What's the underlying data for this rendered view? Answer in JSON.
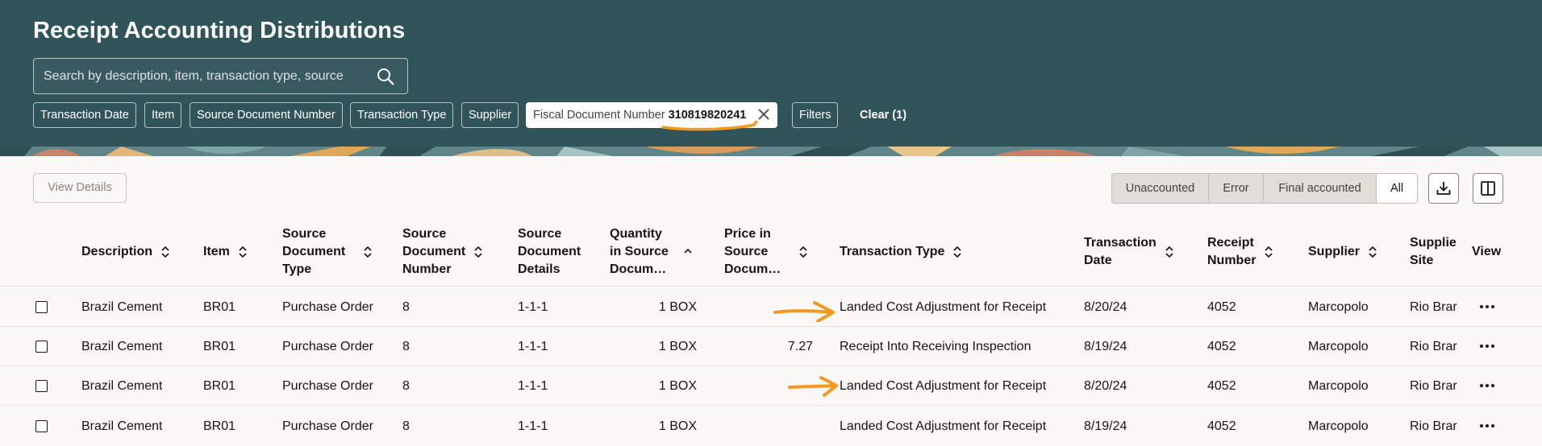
{
  "page": {
    "title": "Receipt Accounting Distributions",
    "search": {
      "placeholder": "Search by description, item, transaction type, source"
    },
    "filter_chips": [
      {
        "label": "Transaction Date"
      },
      {
        "label": "Item"
      },
      {
        "label": "Source Document Number"
      },
      {
        "label": "Transaction Type"
      },
      {
        "label": "Supplier"
      },
      {
        "label": "Fiscal Document Number",
        "value": "310819820241",
        "active": true
      },
      {
        "label": "Filters"
      }
    ],
    "clear_label": "Clear (1)"
  },
  "toolbar": {
    "view_details_label": "View Details",
    "segments": [
      {
        "label": "Unaccounted"
      },
      {
        "label": "Error"
      },
      {
        "label": "Final accounted"
      },
      {
        "label": "All",
        "selected": true
      }
    ],
    "download_icon": "download-icon",
    "columns_icon": "column-layout-icon"
  },
  "table": {
    "columns": [
      {
        "label": "Description"
      },
      {
        "label": "Item"
      },
      {
        "label": "Source\nDocument\nType"
      },
      {
        "label": "Source\nDocument\nNumber"
      },
      {
        "label": "Source\nDocument\nDetails"
      },
      {
        "label": "Quantity\nin Source\nDocum…",
        "sort": "ascending"
      },
      {
        "label": "Price in\nSource\nDocum…"
      },
      {
        "label": "Transaction Type"
      },
      {
        "label": "Transaction\nDate"
      },
      {
        "label": "Receipt\nNumber"
      },
      {
        "label": "Supplier"
      },
      {
        "label": "Supplie\nSite"
      },
      {
        "label": "View"
      }
    ],
    "rows": [
      {
        "description": "Brazil Cement",
        "item": "BR01",
        "source_doc_type": "Purchase Order",
        "source_doc_number": "8",
        "source_doc_details": "1-1-1",
        "quantity": "1 BOX",
        "price": "",
        "transaction_type": "Landed Cost Adjustment for Receipt",
        "transaction_date": "8/20/24",
        "receipt_number": "4052",
        "supplier": "Marcopolo",
        "supplier_site": "Rio Brar"
      },
      {
        "description": "Brazil Cement",
        "item": "BR01",
        "source_doc_type": "Purchase Order",
        "source_doc_number": "8",
        "source_doc_details": "1-1-1",
        "quantity": "1 BOX",
        "price": "7.27",
        "transaction_type": "Receipt Into Receiving Inspection",
        "transaction_date": "8/19/24",
        "receipt_number": "4052",
        "supplier": "Marcopolo",
        "supplier_site": "Rio Brar"
      },
      {
        "description": "Brazil Cement",
        "item": "BR01",
        "source_doc_type": "Purchase Order",
        "source_doc_number": "8",
        "source_doc_details": "1-1-1",
        "quantity": "1 BOX",
        "price": "",
        "transaction_type": "Landed Cost Adjustment for Receipt",
        "transaction_date": "8/20/24",
        "receipt_number": "4052",
        "supplier": "Marcopolo",
        "supplier_site": "Rio Brar"
      },
      {
        "description": "Brazil Cement",
        "item": "BR01",
        "source_doc_type": "Purchase Order",
        "source_doc_number": "8",
        "source_doc_details": "1-1-1",
        "quantity": "1 BOX",
        "price": "",
        "transaction_type": "Landed Cost Adjustment for Receipt",
        "transaction_date": "8/19/24",
        "receipt_number": "4052",
        "supplier": "Marcopolo",
        "supplier_site": "Rio Brar"
      }
    ]
  },
  "annotations": {
    "color": "#f39a1e"
  },
  "colors": {
    "header_bg": "#30545a",
    "page_bg": "#f9f8f6",
    "text": "#161513"
  }
}
